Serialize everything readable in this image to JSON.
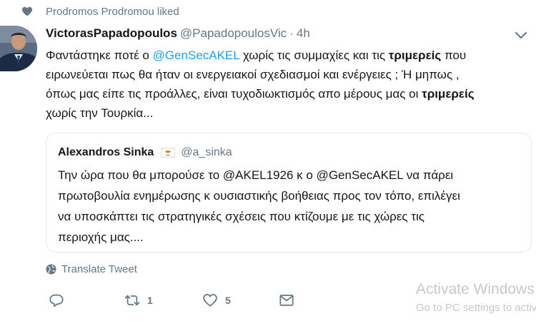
{
  "social_context": {
    "text": "Prodromos Prodromou liked",
    "icon": "heart-icon"
  },
  "tweet": {
    "display_name": "VictorasPapadopoulos",
    "handle": "@PapadopoulosVic",
    "separator": "·",
    "time": "4h",
    "lines": [
      [
        {
          "text": "Φαντάστηκε ποτέ ο ",
          "style": "plain"
        },
        {
          "text": "@GenSecAKEL",
          "style": "mention"
        },
        {
          "text": " χωρίς τις συμμαχίες και τις ",
          "style": "plain"
        },
        {
          "text": "τριμερείς",
          "style": "bold"
        },
        {
          "text": " που",
          "style": "plain"
        }
      ],
      [
        {
          "text": "ειρωνεύεται πως θα ήταν οι ενεργειακοί σχεδιασμοί και ενέργειες   ;  Ή μηπως ,",
          "style": "plain"
        }
      ],
      [
        {
          "text": "όπως μας είπε τις προάλλες, είναι τυχοδιωκτισμός απο μέρους μας οι ",
          "style": "plain"
        },
        {
          "text": "τριμερείς",
          "style": "bold"
        }
      ],
      [
        {
          "text": "χωρίς την Τουρκία...",
          "style": "plain"
        }
      ]
    ]
  },
  "quote": {
    "name": "Alexandros Sinka",
    "handle": "@a_sinka",
    "lines": [
      "Την ώρα που θα μπορούσε το @AKEL1926 κ ο @GenSecAKEL να πάρει",
      "πρωτοβουλία ενημέρωσης κ ουσιαστικής βοήθειας προς τον τόπο, επιλέγει",
      "να υποσκάπτει τις στρατηγικές σχέσεις που κτίζουμε με τις χώρες τις",
      "περιοχής μας...."
    ]
  },
  "translate_label": "Translate Tweet",
  "actions": {
    "reply_count": "",
    "retweet_count": "1",
    "like_count": "5"
  },
  "watermark": {
    "title": "Activate Windows",
    "subtitle": "Go to PC settings to activate Windows."
  },
  "colors": {
    "text": "#14171a",
    "secondary": "#657786",
    "mention": "#1da1f2",
    "border": "#e1e8ed",
    "watermark": "#c6c9cc"
  }
}
